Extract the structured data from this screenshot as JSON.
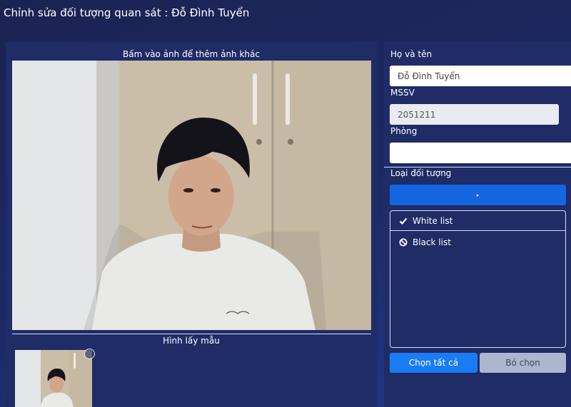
{
  "page": {
    "title": "Chỉnh sửa đối tượng quan sát : Đỗ Đình Tuyển"
  },
  "photo": {
    "caption": "Bấm vào ảnh để thêm ảnh khác",
    "samples_caption": "Hình lấy mẫu"
  },
  "form": {
    "name_label": "Họ và tên",
    "name_value": "Đỗ Đình Tuyển",
    "student_id_label": "MSSV",
    "student_id_value": "2051211",
    "room_label": "Phòng",
    "room_value": "",
    "type_label": "Loại đối tượng",
    "dropdown_arrow": "▸",
    "type_options": [
      {
        "label": "White list",
        "icon": "check-icon",
        "selected": true
      },
      {
        "label": "Black list",
        "icon": "ban-icon",
        "selected": false
      }
    ],
    "select_all_label": "Chọn tất cả",
    "deselect_label": "Bỏ chọn"
  },
  "colors": {
    "primary": "#1a7cf5",
    "dropdown": "#1565e0",
    "panel": "#1f2c66",
    "disabled_button": "#aeb6cf"
  }
}
